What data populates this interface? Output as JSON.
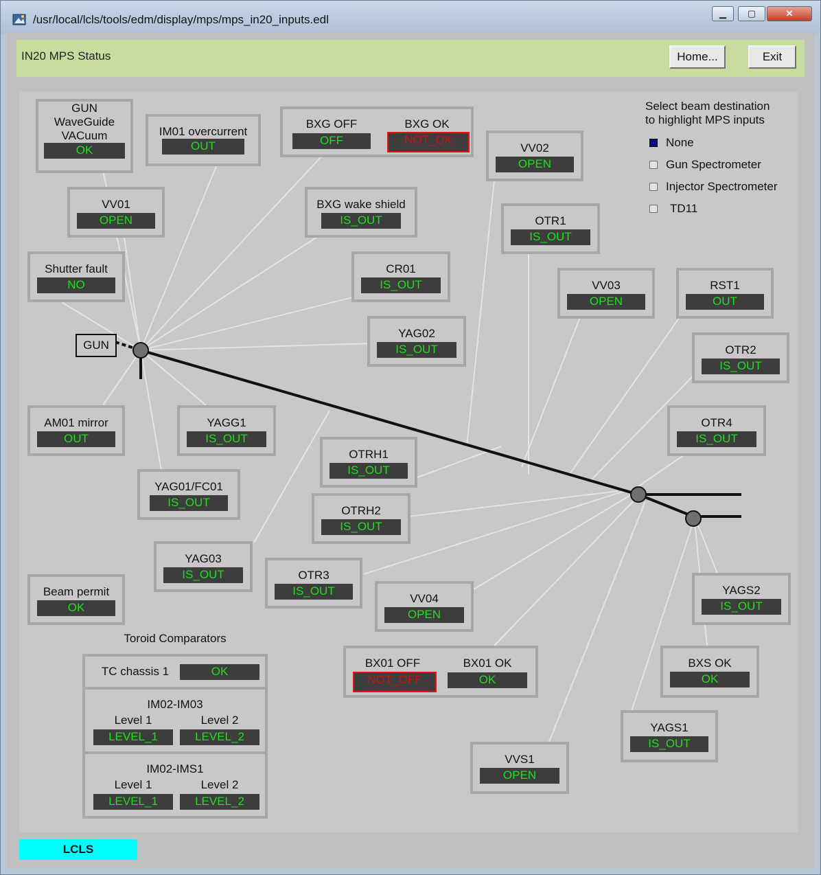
{
  "window": {
    "title": "/usr/local/lcls/tools/edm/display/mps/mps_in20_inputs.edl",
    "min_label": "▁",
    "max_label": "▢",
    "close_label": "✕"
  },
  "header": {
    "title": "IN20 MPS Status",
    "home_label": "Home...",
    "exit_label": "Exit"
  },
  "destination": {
    "heading_line1": "Select beam destination",
    "heading_line2": "to highlight MPS inputs",
    "options": [
      "None",
      "Gun Spectrometer",
      "Injector Spectrometer",
      "TD11"
    ],
    "selected": "None"
  },
  "gun_label": "GUN",
  "devices": {
    "gun_waveguide": {
      "l1": "GUN",
      "l2": "WaveGuide",
      "l3": "VACuum",
      "value": "OK"
    },
    "im01": {
      "label": "IM01 overcurrent",
      "value": "OUT"
    },
    "bxg_off": {
      "label": "BXG OFF",
      "value": "OFF"
    },
    "bxg_ok": {
      "label": "BXG OK",
      "value": "NOT_OK"
    },
    "vv02": {
      "label": "VV02",
      "value": "OPEN"
    },
    "vv01": {
      "label": "VV01",
      "value": "OPEN"
    },
    "bxg_wake": {
      "label": "BXG wake shield",
      "value": "IS_OUT"
    },
    "otr1": {
      "label": "OTR1",
      "value": "IS_OUT"
    },
    "shutter": {
      "label": "Shutter fault",
      "value": "NO"
    },
    "cr01": {
      "label": "CR01",
      "value": "IS_OUT"
    },
    "vv03": {
      "label": "VV03",
      "value": "OPEN"
    },
    "rst1": {
      "label": "RST1",
      "value": "OUT"
    },
    "yag02": {
      "label": "YAG02",
      "value": "IS_OUT"
    },
    "otr2": {
      "label": "OTR2",
      "value": "IS_OUT"
    },
    "am01": {
      "label": "AM01 mirror",
      "value": "OUT"
    },
    "yagg1": {
      "label": "YAGG1",
      "value": "IS_OUT"
    },
    "otrh1": {
      "label": "OTRH1",
      "value": "IS_OUT"
    },
    "otr4": {
      "label": "OTR4",
      "value": "IS_OUT"
    },
    "yag01": {
      "label": "YAG01/FC01",
      "value": "IS_OUT"
    },
    "otrh2": {
      "label": "OTRH2",
      "value": "IS_OUT"
    },
    "yag03": {
      "label": "YAG03",
      "value": "IS_OUT"
    },
    "otr3": {
      "label": "OTR3",
      "value": "IS_OUT"
    },
    "beam_permit": {
      "label": "Beam permit",
      "value": "OK"
    },
    "vv04": {
      "label": "VV04",
      "value": "OPEN"
    },
    "yags2": {
      "label": "YAGS2",
      "value": "IS_OUT"
    },
    "bx01_off": {
      "label": "BX01 OFF",
      "value": "NOT_OFF"
    },
    "bx01_ok": {
      "label": "BX01 OK",
      "value": "OK"
    },
    "bxs_ok": {
      "label": "BXS OK",
      "value": "OK"
    },
    "yags1": {
      "label": "YAGS1",
      "value": "IS_OUT"
    },
    "vvs1": {
      "label": "VVS1",
      "value": "OPEN"
    }
  },
  "toroid": {
    "heading": "Toroid Comparators",
    "tc_chassis": {
      "label": "TC chassis 1",
      "value": "OK"
    },
    "im02_im03": {
      "title": "IM02-IM03",
      "level1_label": "Level 1",
      "level2_label": "Level 2",
      "level1_value": "LEVEL_1",
      "level2_value": "LEVEL_2"
    },
    "im02_ims1": {
      "title": "IM02-IMS1",
      "level1_label": "Level 1",
      "level2_label": "Level 2",
      "level1_value": "LEVEL_1",
      "level2_value": "LEVEL_2"
    }
  },
  "footer": {
    "badge": "LCLS"
  },
  "colors": {
    "ok_text": "#1ee01e",
    "alarm_text": "#d01010",
    "value_bg": "#3d3d3d",
    "header_bg": "#c8dca0",
    "lcls_badge": "#00ffff"
  }
}
